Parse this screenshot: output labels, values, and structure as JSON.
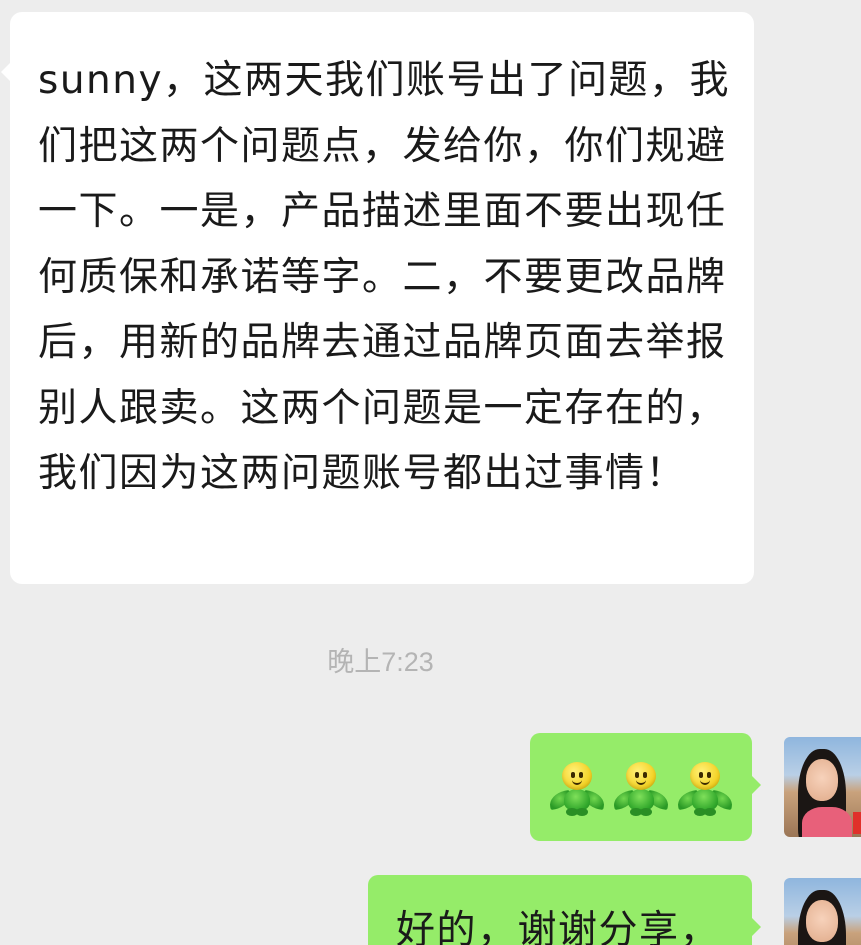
{
  "chat": {
    "incoming": {
      "text": "sunny，这两天我们账号出了问题，我们把这两个问题点，发给你，你们规避一下。一是，产品描述里面不要出现任何质保和承诺等字。二，不要更改品牌后，用新的品牌去通过品牌页面去举报别人跟卖。这两个问题是一定存在的，我们因为这两问题账号都出过事情！"
    },
    "timestamp": "晚上7:23",
    "outgoing": [
      {
        "type": "emoji",
        "emoji_icon": "sprout-emoji",
        "emoji_count": 3
      },
      {
        "type": "text",
        "text": "好的，谢谢分享，"
      }
    ]
  },
  "colors": {
    "background": "#ededed",
    "incoming_bubble": "#ffffff",
    "outgoing_bubble": "#95ec69",
    "timestamp_text": "#b4b4b4"
  }
}
